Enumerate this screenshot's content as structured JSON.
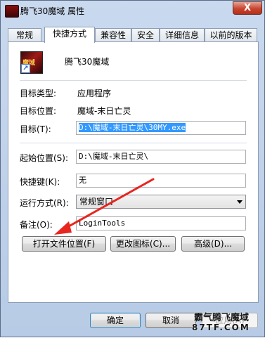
{
  "window": {
    "title": "腾飞30魔域 属性",
    "close_label": "X"
  },
  "tabs": [
    {
      "label": "常规"
    },
    {
      "label": "快捷方式"
    },
    {
      "label": "兼容性"
    },
    {
      "label": "安全"
    },
    {
      "label": "详细信息"
    },
    {
      "label": "以前的版本"
    }
  ],
  "active_tab": "快捷方式",
  "shortcut": {
    "name": "腾飞30魔域",
    "icon_text": "魔域",
    "fields": {
      "target_type_label": "目标类型:",
      "target_type_value": "应用程序",
      "target_location_label": "目标位置:",
      "target_location_value": "魔域-末日亡灵",
      "target_label": "目标(T):",
      "target_value": "D:\\魔域-末日亡灵\\30MY.exe",
      "start_in_label": "起始位置(S):",
      "start_in_value": "D:\\魔域-末日亡灵\\",
      "hotkey_label": "快捷键(K):",
      "hotkey_value": "无",
      "run_label": "运行方式(R):",
      "run_value": "常规窗口",
      "comment_label": "备注(O):",
      "comment_value": "LoginTools"
    },
    "buttons": {
      "open_location": "打开文件位置(F)",
      "change_icon": "更改图标(C)...",
      "advanced": "高级(D)..."
    }
  },
  "footer": {
    "ok": "确定",
    "cancel": "取消",
    "apply": "应用(A)"
  },
  "watermark": {
    "line1": "霸气腾飞魔域",
    "line2": "87TF.COM"
  },
  "annotation": {
    "arrow_color": "#e8251f"
  }
}
